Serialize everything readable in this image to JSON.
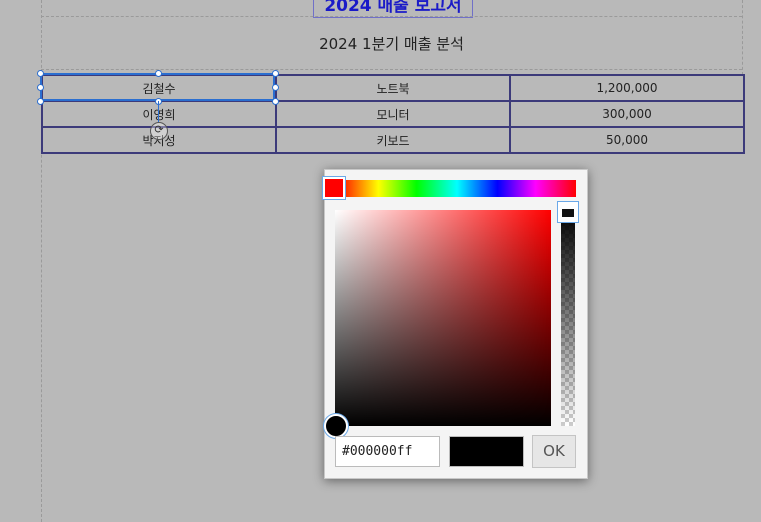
{
  "document": {
    "title": "2024 매출 보고서",
    "subtitle": "2024 1분기 매출 분석"
  },
  "table": {
    "rows": [
      [
        "김철수",
        "노트북",
        "1,200,000"
      ],
      [
        "이영희",
        "모니터",
        "300,000"
      ],
      [
        "박지성",
        "키보드",
        "50,000"
      ]
    ]
  },
  "color_picker": {
    "hex_value": "#000000ff",
    "ok_label": "OK",
    "hue_color": "#ff0000",
    "selected_color": "#000000",
    "alpha_percent": 100
  },
  "colors": {
    "title_text": "#1a1ac8",
    "table_border": "#3c3a7a",
    "selection": "#2a6ed0"
  }
}
